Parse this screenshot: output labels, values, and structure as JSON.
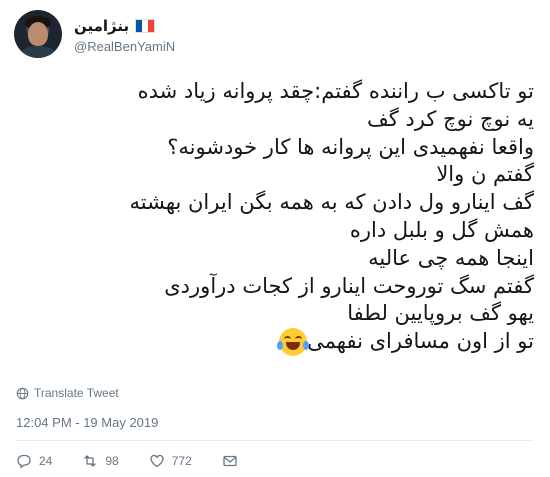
{
  "user": {
    "display_name": "بنژامین",
    "flag_icon": "france-flag-icon",
    "handle": "@RealBenYamiN"
  },
  "tweet": {
    "lines": [
      "تو تاکسی ب راننده گفتم:چقد پروانه زیاد شده",
      "یه نوچ نوچ کرد گف",
      "واقعا نفهمیدی این پروانه ها کار خودشونه؟",
      "گفتم ن والا",
      "گف اینارو ول دادن که به همه بگن ایران بهشته",
      "همش گل و بلبل داره",
      "اینجا همه چی عالیه",
      "گفتم سگ توروحت اینارو از کجات درآوردی",
      "یهو گف بروپایین لطفا",
      "تو از اون مسافرای نفهمی"
    ],
    "emoji_icon": "face-with-tears-of-joy-icon"
  },
  "translate_label": "Translate Tweet",
  "timestamp": "12:04 PM - 19 May 2019",
  "stats": {
    "replies": "24",
    "retweets": "98",
    "likes": "772"
  },
  "colors": {
    "text": "#14171a",
    "muted": "#657786",
    "divider": "#e6ecf0"
  }
}
